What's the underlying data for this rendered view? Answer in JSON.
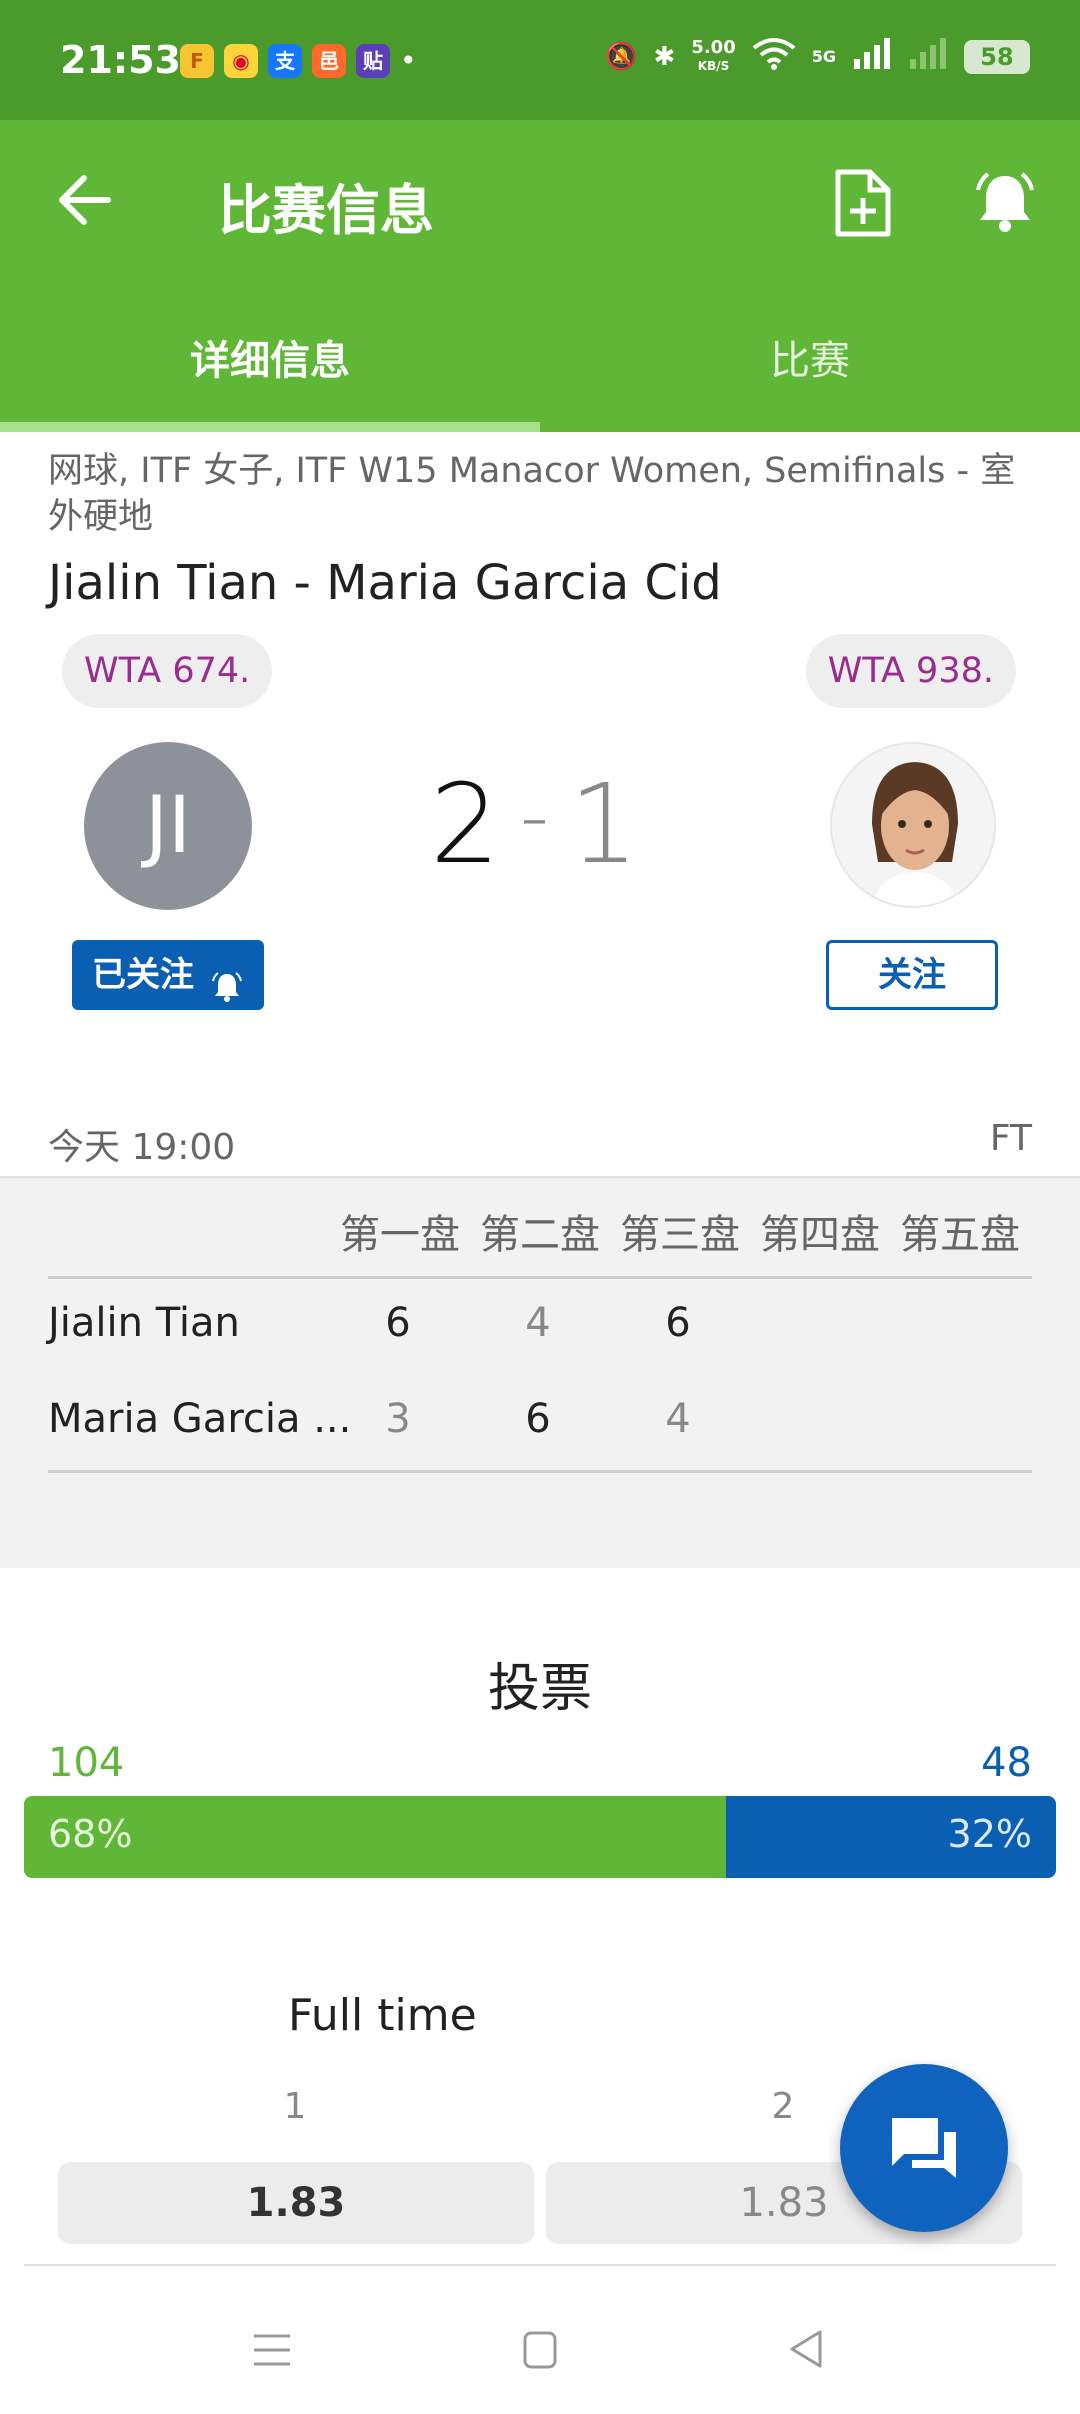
{
  "status_bar": {
    "time": "21:53",
    "speed_value": "5.00",
    "speed_unit": "KB/S",
    "network": "5G",
    "battery": "58",
    "app_icons": [
      "app-a-icon",
      "weibo-icon",
      "alipay-icon",
      "app-d-icon",
      "app-e-icon"
    ]
  },
  "appbar": {
    "title": "比赛信息",
    "icons": [
      "back-arrow-icon",
      "add-document-icon",
      "bell-icon"
    ]
  },
  "tabs": [
    {
      "label": "详细信息",
      "active": true
    },
    {
      "label": "比赛",
      "active": false
    }
  ],
  "match": {
    "breadcrumb": "网球, ITF 女子, ITF W15 Manacor Women, Semifinals - 室外硬地",
    "title": "Jialin Tian - Maria Garcia Cid",
    "left": {
      "ranking": "WTA 674.",
      "initials": "JI",
      "follow_label": "已关注"
    },
    "right": {
      "ranking": "WTA 938.",
      "follow_label": "关注"
    },
    "score_left": "2",
    "score_sep": "-",
    "score_right": "1",
    "date": "今天 19:00",
    "status": "FT"
  },
  "sets": {
    "headers": [
      "第一盘",
      "第二盘",
      "第三盘",
      "第四盘",
      "第五盘"
    ],
    "rows": [
      {
        "name": "Jialin Tian",
        "scores": [
          "6",
          "4",
          "6"
        ]
      },
      {
        "name": "Maria Garcia ...",
        "scores": [
          "3",
          "6",
          "4"
        ]
      }
    ]
  },
  "vote": {
    "title": "投票",
    "left_count": "104",
    "right_count": "48",
    "left_pct": "68%",
    "right_pct": "32%",
    "left_share": 0.68,
    "colors": {
      "home": "#5fb637",
      "away": "#0b5fb3"
    }
  },
  "odds": {
    "title": "Full time",
    "labels": [
      "1",
      "2"
    ],
    "values": [
      "1.83",
      "1.83"
    ]
  },
  "colors": {
    "accent": "#5fb637",
    "primary_blue": "#0b5fb3"
  }
}
